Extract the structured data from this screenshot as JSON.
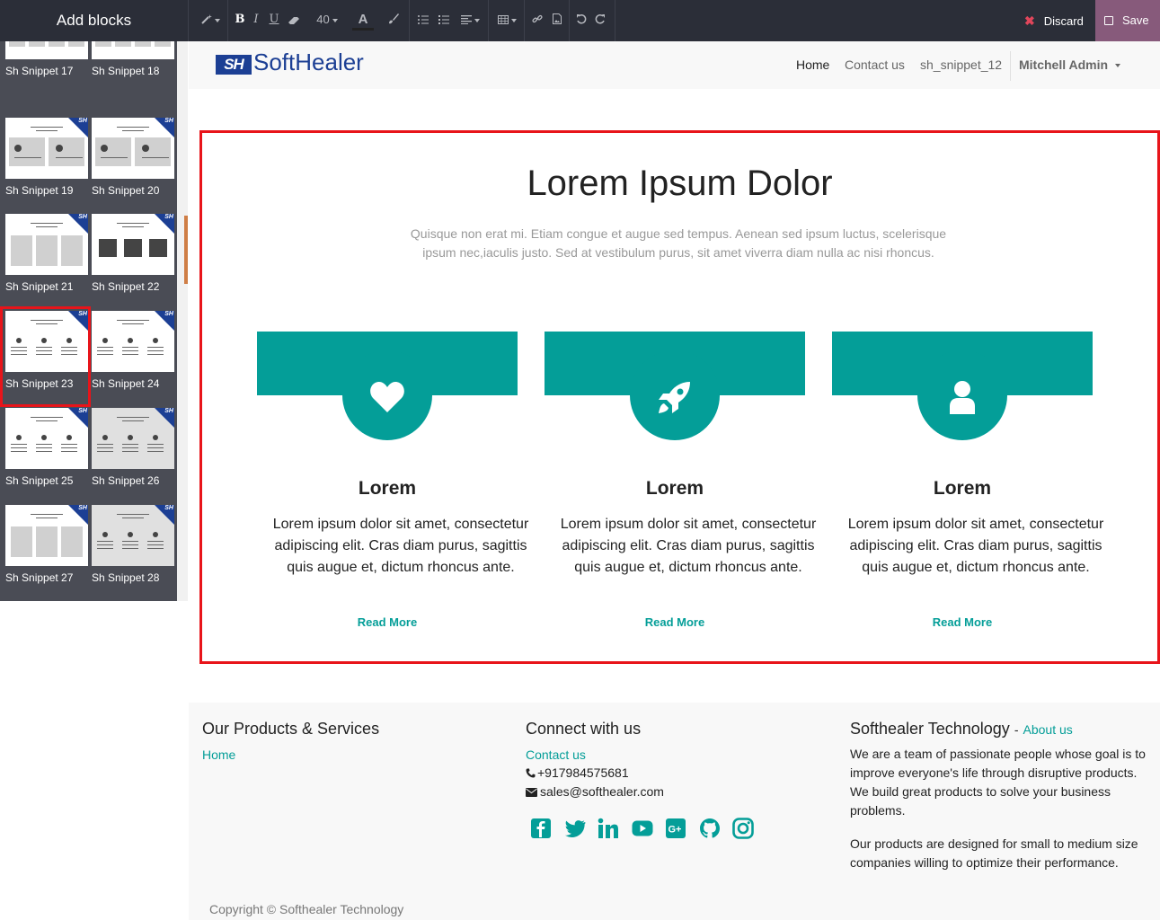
{
  "toolbar": {
    "title": "Add blocks",
    "font_size": "40",
    "discard_label": "Discard",
    "save_label": "Save",
    "accent_color": "#875a7b"
  },
  "snippets": [
    {
      "label": "Sh Snippet 17"
    },
    {
      "label": "Sh Snippet 18"
    },
    {
      "label": "Sh Snippet 19"
    },
    {
      "label": "Sh Snippet 20"
    },
    {
      "label": "Sh Snippet 21"
    },
    {
      "label": "Sh Snippet 22"
    },
    {
      "label": "Sh Snippet 23"
    },
    {
      "label": "Sh Snippet 24"
    },
    {
      "label": "Sh Snippet 25"
    },
    {
      "label": "Sh Snippet 26"
    },
    {
      "label": "Sh Snippet 27"
    },
    {
      "label": "Sh Snippet 28"
    }
  ],
  "snippet_corner_badge": "SH",
  "header": {
    "logo_mark": "SH",
    "logo_text": "SoftHealer",
    "nav": [
      "Home",
      "Contact us",
      "sh_snippet_12"
    ],
    "user": "Mitchell Admin"
  },
  "section": {
    "title": "Lorem Ipsum Dolor",
    "subtitle": "Quisque non erat mi. Etiam congue et augue sed tempus. Aenean sed ipsum luctus, scelerisque ipsum nec,iaculis justo. Sed at vestibulum purus, sit amet viverra diam nulla ac nisi rhoncus.",
    "accent_color": "#049e98",
    "cards": [
      {
        "icon": "heart-icon",
        "title": "Lorem",
        "text": "Lorem ipsum dolor sit amet, consectetur adipiscing elit. Cras diam purus, sagittis quis augue et, dictum rhoncus ante.",
        "link": "Read More"
      },
      {
        "icon": "rocket-icon",
        "title": "Lorem",
        "text": "Lorem ipsum dolor sit amet, consectetur adipiscing elit. Cras diam purus, sagittis quis augue et, dictum rhoncus ante.",
        "link": "Read More"
      },
      {
        "icon": "user-icon",
        "title": "Lorem",
        "text": "Lorem ipsum dolor sit amet, consectetur adipiscing elit. Cras diam purus, sagittis quis augue et, dictum rhoncus ante.",
        "link": "Read More"
      }
    ]
  },
  "footer": {
    "col1_title": "Our Products & Services",
    "col1_link": "Home",
    "col2_title": "Connect with us",
    "col2_link": "Contact us",
    "phone": "+917984575681",
    "email": "sales@softhealer.com",
    "social_icons": [
      "facebook-icon",
      "twitter-icon",
      "linkedin-icon",
      "youtube-icon",
      "google-plus-icon",
      "github-icon",
      "instagram-icon"
    ],
    "col3_title": "Softhealer Technology",
    "col3_title_sep": "-",
    "col3_link": "About us",
    "about_p1": "We are a team of passionate people whose goal is to improve everyone's life through disruptive products. We build great products to solve your business problems.",
    "about_p2": "Our products are designed for small to medium size companies willing to optimize their performance.",
    "copyright": "Copyright © Softhealer Technology"
  }
}
